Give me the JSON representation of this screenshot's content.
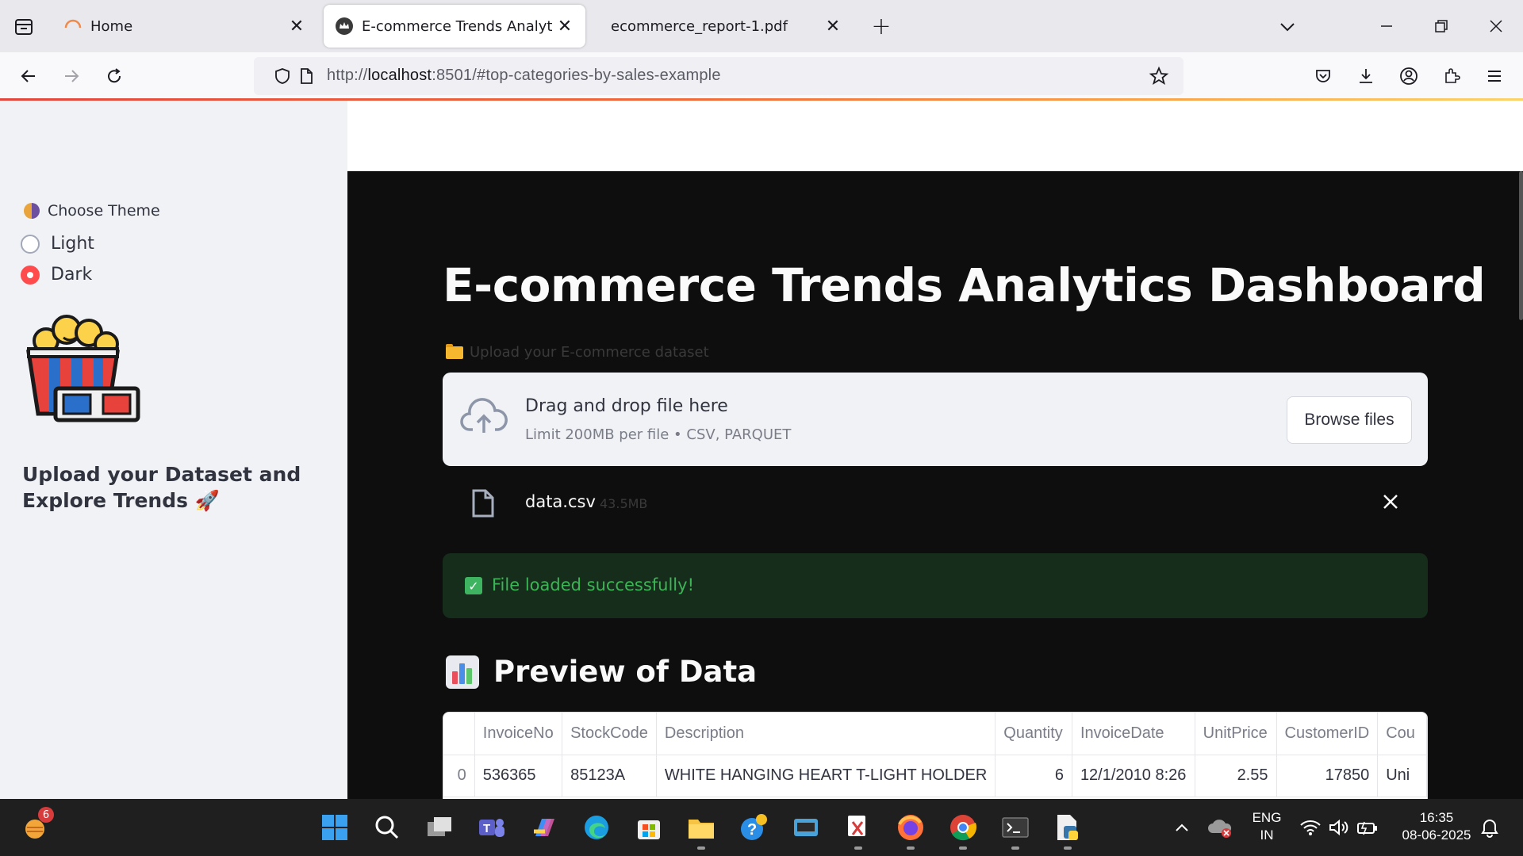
{
  "browser": {
    "tabs": [
      {
        "title": "Home",
        "active": false
      },
      {
        "title": "E-commerce Trends Analytics",
        "active": true
      },
      {
        "title": "ecommerce_report-1.pdf",
        "active": false
      }
    ],
    "url_prefix": "http://",
    "url_host": "localhost",
    "url_rest": ":8501/#top-categories-by-sales-example"
  },
  "sidebar": {
    "theme_label": "Choose Theme",
    "theme_options": [
      "Light",
      "Dark"
    ],
    "selected_theme": "Dark",
    "heading": "Upload your Dataset and Explore Trends 🚀"
  },
  "main": {
    "title": "E-commerce Trends Analytics Dashboard",
    "upload_label": "Upload your E-commerce dataset",
    "dropzone_title": "Drag and drop file here",
    "dropzone_sub": "Limit 200MB per file • CSV, PARQUET",
    "browse_label": "Browse files",
    "file_name": "data.csv",
    "file_size": "43.5MB",
    "success_msg": "File loaded successfully!",
    "preview_heading": "Preview of Data",
    "table": {
      "columns": [
        "",
        "InvoiceNo",
        "StockCode",
        "Description",
        "Quantity",
        "InvoiceDate",
        "UnitPrice",
        "CustomerID",
        "Cou"
      ],
      "rows": [
        [
          "0",
          "536365",
          "85123A",
          "WHITE HANGING HEART T-LIGHT HOLDER",
          "6",
          "12/1/2010 8:26",
          "2.55",
          "17850",
          "Uni"
        ]
      ]
    }
  },
  "taskbar": {
    "weather_badge": "6",
    "lang_line1": "ENG",
    "lang_line2": "IN",
    "time": "16:35",
    "date": "08-06-2025"
  },
  "colors": {
    "accent_red": "#ff4b4b",
    "success_green": "#3cb557",
    "dark_bg": "#0e0e0e"
  }
}
